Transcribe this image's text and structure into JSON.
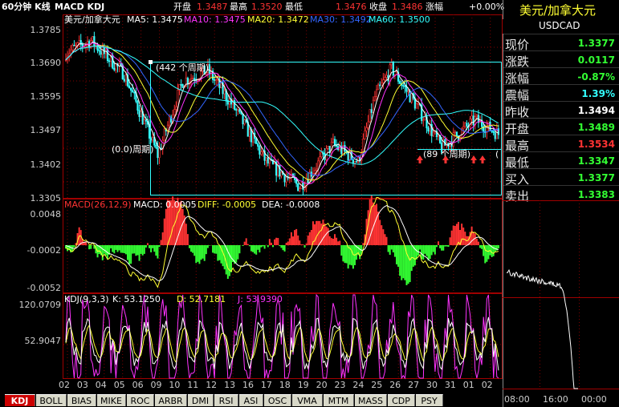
{
  "header": {
    "period_label": "60分钟 K线",
    "indicators_label": "MACD KDJ",
    "open_label": "开盘",
    "open_value": "1.3487",
    "high_label": "最高",
    "high_value": "1.3520",
    "low_label": "最低",
    "low_value": "1.3476",
    "close_label": "收盘",
    "close_value": "1.3486",
    "change_label": "涨幅",
    "change_value": "+0.00%"
  },
  "price_panel": {
    "legend_name": "美元/加拿大元",
    "ma5": "MA5: 1.3475",
    "ma10": "MA10: 1.3475",
    "ma20": "MA20: 1.3472",
    "ma30": "MA30: 1.3492",
    "ma60": "MA60: 1.3500",
    "y_ticks": [
      "1.3785",
      "1.3690",
      "1.3595",
      "1.3497",
      "1.3402",
      "1.3305"
    ],
    "annotation_1": "(442 个周期)",
    "annotation_2": "(0.0)周期)",
    "annotation_3": "(89 个周期)",
    "annotation_4": "("
  },
  "macd_panel": {
    "legend": "MACD(26,12,9)",
    "macd": "MACD: 0.0005",
    "diff": "DIFF: -0.0005",
    "dea": "DEA: -0.0008",
    "y_ticks": [
      "0.0048",
      "-0.0002",
      "-0.0052"
    ]
  },
  "kdj_panel": {
    "legend": "KDJ(9,3,3)",
    "k": "K: 53.1250",
    "d": "D: 52.7181",
    "j": "J: 53.9390",
    "y_ticks": [
      "120.0709",
      "52.9047"
    ]
  },
  "x_axis": [
    "02",
    "03",
    "04",
    "05",
    "06",
    "09",
    "10",
    "11",
    "12",
    "13",
    "16",
    "17",
    "18",
    "19",
    "20",
    "23",
    "24",
    "25",
    "26",
    "27",
    "30",
    "31",
    "01",
    "02"
  ],
  "side_panel": {
    "title": "美元/加拿大元",
    "symbol": "USDCAD",
    "rows": [
      {
        "label": "现价",
        "value": "1.3377",
        "color": "#33ff33"
      },
      {
        "label": "涨跌",
        "value": "0.0117",
        "color": "#33ff33"
      },
      {
        "label": "涨幅",
        "value": "-0.87%",
        "color": "#33ff33"
      },
      {
        "label": "震幅",
        "value": "1.39%",
        "color": "#33ffff"
      },
      {
        "label": "昨收",
        "value": "1.3494",
        "color": "#ffffff"
      },
      {
        "label": "开盘",
        "value": "1.3489",
        "color": "#33ff33"
      },
      {
        "label": "最高",
        "value": "1.3534",
        "color": "#ff3333"
      },
      {
        "label": "最低",
        "value": "1.3347",
        "color": "#33ff33"
      },
      {
        "label": "买入",
        "value": "1.3377",
        "color": "#33ff33"
      },
      {
        "label": "卖出",
        "value": "1.3383",
        "color": "#33ff33"
      }
    ],
    "time_ticks": [
      "08:00",
      "16:00",
      "00:00"
    ]
  },
  "tabs": [
    "KDJ",
    "BOLL",
    "BIAS",
    "MIKE",
    "ROC",
    "ARBR",
    "DMI",
    "RSI",
    "ASI",
    "OSC",
    "VMA",
    "MTM",
    "MASS",
    "CDP",
    "PSY"
  ],
  "colors": {
    "up": "#ff3333",
    "down": "#33ffff",
    "grid": "#800000",
    "accent": "#33ff33"
  }
}
